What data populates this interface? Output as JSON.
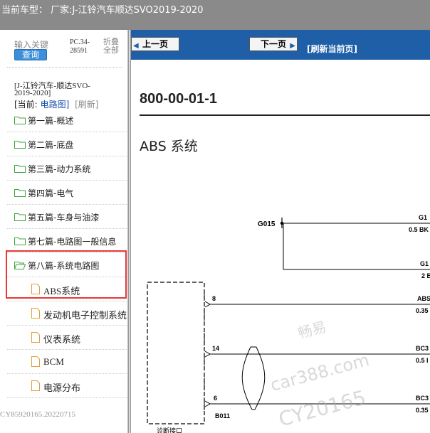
{
  "titlebar": {
    "title": "当前车型： 厂家:J-江铃汽车顺达SVO2019-2020"
  },
  "left_panel": {
    "keyword_label": "输入关键",
    "search_label": "查询",
    "pc_code": "PC.34-28591",
    "collapse_label": "折叠全部",
    "model": "[J-江铃汽车-顺达SVO-2019-2020]",
    "current_prefix": "[当前:",
    "current_value": "电路图]",
    "refresh_label": "[刷新]",
    "tree": [
      {
        "label": "第一篇-概述",
        "icon": "folder-icon"
      },
      {
        "label": "第二篇-底盘",
        "icon": "folder-icon"
      },
      {
        "label": "第三篇-动力系统",
        "icon": "folder-icon"
      },
      {
        "label": "第四篇-电气",
        "icon": "folder-icon"
      },
      {
        "label": "第五篇-车身与油漆",
        "icon": "folder-icon"
      },
      {
        "label": "第七篇-电路图一般信息",
        "icon": "folder-icon"
      },
      {
        "label": "第八篇-系统电路图",
        "icon": "folder-open-icon"
      },
      {
        "label": "ABS系统",
        "icon": "file-icon"
      },
      {
        "label": "发动机电子控制系统",
        "icon": "file-icon"
      },
      {
        "label": "仪表系统",
        "icon": "file-icon"
      },
      {
        "label": "BCM",
        "icon": "file-icon"
      },
      {
        "label": "电源分布",
        "icon": "file-icon"
      }
    ],
    "footer_id": "CY85920165.20220715"
  },
  "right_panel": {
    "prev_label": "上一页",
    "next_label": "下一页",
    "refresh_page_label": "[刷新当前页]",
    "page_code": "800-00-01-1",
    "section_title": "ABS 系统",
    "diagram": {
      "ground_label": "G015",
      "connector_label": "B011",
      "connector_caption": "诊断接口",
      "pins": [
        "8",
        "14",
        "6"
      ],
      "wires": [
        {
          "code": "G1",
          "spec": "0.5 BK"
        },
        {
          "code": "G1",
          "spec": "2 B"
        },
        {
          "code": "ABS",
          "spec": "0.35"
        },
        {
          "code": "BC3",
          "spec": "0.5 I"
        },
        {
          "code": "BC3",
          "spec": "0.35"
        }
      ]
    },
    "watermark": [
      "畅易",
      "car388.com",
      "CY20165"
    ]
  }
}
